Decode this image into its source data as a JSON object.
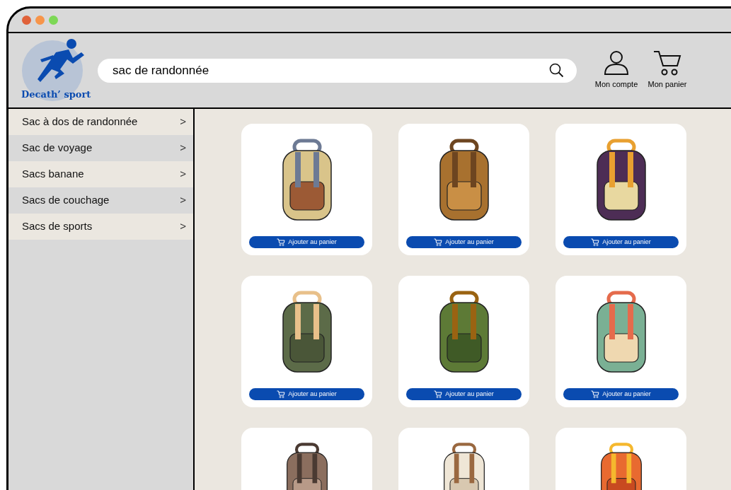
{
  "logo": {
    "text": "Decath’ sport"
  },
  "search": {
    "value": "sac de randonnée"
  },
  "header_links": [
    {
      "kind": "account",
      "label": "Mon compte"
    },
    {
      "kind": "cart",
      "label": "Mon panier"
    }
  ],
  "sidebar": {
    "items": [
      {
        "label": "Sac à dos de randonnée",
        "chevron": ">"
      },
      {
        "label": "Sac de voyage",
        "chevron": ">"
      },
      {
        "label": "Sacs banane",
        "chevron": ">"
      },
      {
        "label": "Sacs de couchage",
        "chevron": ">"
      },
      {
        "label": "Sacs de sports",
        "chevron": ">"
      }
    ]
  },
  "products": [
    {
      "button": "Ajouter au panier"
    },
    {
      "button": "Ajouter au panier"
    },
    {
      "button": "Ajouter au panier"
    },
    {
      "button": "Ajouter au panier"
    },
    {
      "button": "Ajouter au panier"
    },
    {
      "button": "Ajouter au panier"
    },
    {
      "kind": "cut_off"
    },
    {
      "kind": "cut_off"
    },
    {
      "kind": "cut_off"
    }
  ]
}
